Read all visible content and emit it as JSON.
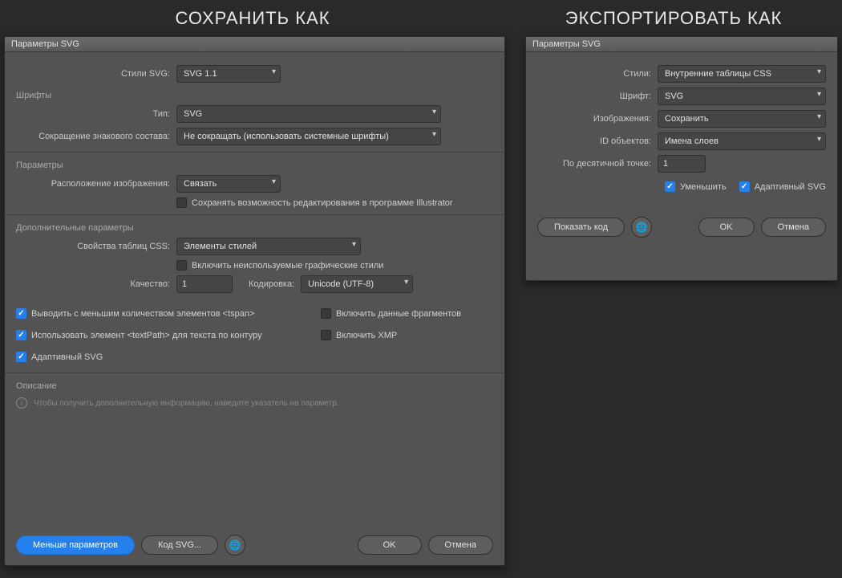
{
  "headers": {
    "left": "СОХРАНИТЬ КАК",
    "right": "ЭКСПОРТИРОВАТЬ КАК"
  },
  "dialog_left": {
    "title": "Параметры SVG",
    "styles_label": "Стили SVG:",
    "styles_value": "SVG 1.1",
    "fonts_section": "Шрифты",
    "type_label": "Тип:",
    "type_value": "SVG",
    "subset_label": "Сокращение знакового состава:",
    "subset_value": "Не сокращать (использовать системные шрифты)",
    "params_section": "Параметры",
    "image_loc_label": "Расположение изображения:",
    "image_loc_value": "Связать",
    "preserve_edit_label": "Сохранять возможность редактирования в программе Illustrator",
    "advanced_section": "Дополнительные параметры",
    "css_props_label": "Свойства таблиц CSS:",
    "css_props_value": "Элементы стилей",
    "include_unused_label": "Включить неиспользуемые графические стили",
    "quality_label": "Качество:",
    "quality_value": "1",
    "encoding_label": "Кодировка:",
    "encoding_value": "Unicode (UTF-8)",
    "fewer_tspan_label": "Выводить с меньшим количеством элементов <tspan>",
    "include_fragments_label": "Включить данные фрагментов",
    "use_textpath_label": "Использовать элемент <textPath> для текста по контуру",
    "include_xmp_label": "Включить XMP",
    "adaptive_svg_label": "Адаптивный SVG",
    "desc_section": "Описание",
    "desc_text": "Чтобы получить дополнительную информацию, наведите указатель на параметр.",
    "fewer_params_btn": "Меньше параметров",
    "svg_code_btn": "Код SVG...",
    "ok_btn": "OK",
    "cancel_btn": "Отмена"
  },
  "dialog_right": {
    "title": "Параметры SVG",
    "styles_label": "Стили:",
    "styles_value": "Внутренние таблицы CSS",
    "font_label": "Шрифт:",
    "font_value": "SVG",
    "images_label": "Изображения:",
    "images_value": "Сохранить",
    "object_ids_label": "ID объектов:",
    "object_ids_value": "Имена слоев",
    "decimal_label": "По десятичной точке:",
    "decimal_value": "1",
    "minify_label": "Уменьшить",
    "adaptive_label": "Адаптивный SVG",
    "show_code_btn": "Показать код",
    "ok_btn": "OK",
    "cancel_btn": "Отмена"
  }
}
